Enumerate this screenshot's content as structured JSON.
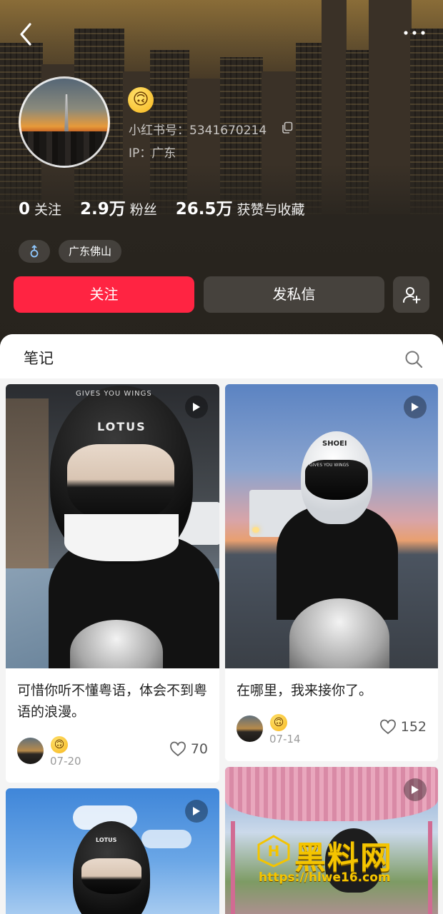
{
  "profile": {
    "emoji_name": "upside-down-face",
    "emoji_char": "🙃",
    "red_id": "小红书号：5341670214",
    "ip": "IP：广东",
    "stats": [
      {
        "value": "0",
        "label": "关注"
      },
      {
        "value": "2.9万",
        "label": "粉丝"
      },
      {
        "value": "26.5万",
        "label": "获赞与收藏"
      }
    ],
    "gender_icon": "male-icon",
    "location_tag": "广东佛山",
    "follow_label": "关注",
    "message_label": "发私信"
  },
  "notes_tab": {
    "label": "笔记"
  },
  "notes": [
    {
      "title": "可惜你听不懂粤语，体会不到粤语的浪漫。",
      "date": "07-20",
      "likes": "70",
      "emoji": "🙃",
      "video": true
    },
    {
      "title": "在哪里，我来接你了。",
      "date": "07-14",
      "likes": "152",
      "emoji": "🙃",
      "video": true
    },
    {
      "title": "",
      "date": "",
      "likes": "",
      "emoji": "",
      "video": true
    },
    {
      "title": "",
      "date": "",
      "likes": "",
      "emoji": "",
      "video": true
    }
  ],
  "cover_text": {
    "helmet_brand_1": "LOTUS",
    "helmet_strap_1": "GIVES YOU WINGS",
    "helmet_brand_2": "SHOEI",
    "helmet_strap_2": "GIVES YOU WINGS",
    "helmet_brand_3": "LOTUS"
  },
  "watermark": {
    "name": "黑料网",
    "url": "https://hlwe16.com"
  },
  "colors": {
    "accent": "#ff2442",
    "watermark": "#f4c400"
  }
}
